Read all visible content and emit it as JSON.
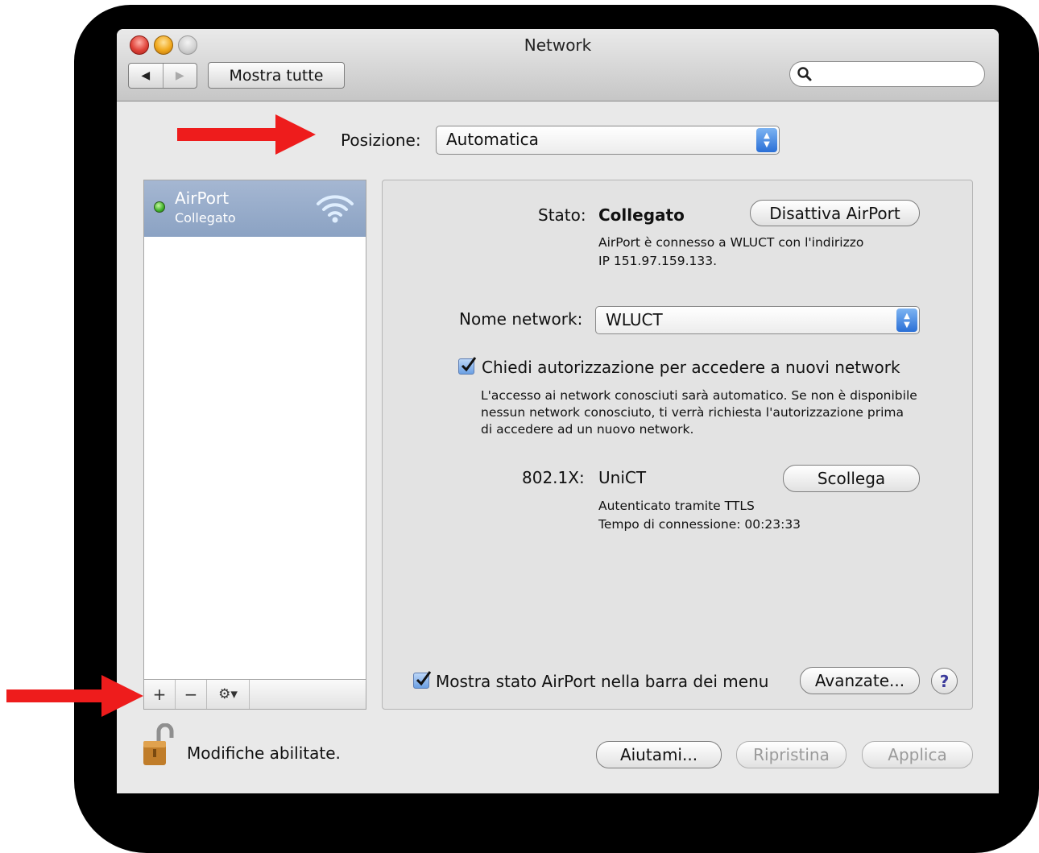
{
  "window": {
    "title": "Network",
    "toolbar": {
      "back_glyph": "◀",
      "forward_glyph": "▶",
      "show_all": "Mostra tutte",
      "search_value": ""
    }
  },
  "location": {
    "label": "Posizione:",
    "value": "Automatica"
  },
  "sidebar": {
    "services": [
      {
        "name": "AirPort",
        "status": "Collegato",
        "status_color": "#3eb12a",
        "icon": "wifi-icon"
      }
    ],
    "tools": {
      "add": "+",
      "remove": "−",
      "gear": "⚙▾"
    }
  },
  "detail": {
    "status_label": "Stato:",
    "status_value": "Collegato",
    "turn_off_button": "Disattiva AirPort",
    "status_desc_line1": "AirPort è connesso a WLUCT con l'indirizzo",
    "status_desc_line2": "IP 151.97.159.133.",
    "network_name_label": "Nome network:",
    "network_name_value": "WLUCT",
    "ask_join_label": "Chiedi autorizzazione per accedere a nuovi network",
    "ask_join_checked": true,
    "ask_join_desc_line1": "L'accesso ai network conosciuti sarà automatico. Se non è disponibile",
    "ask_join_desc_line2": "nessun network conosciuto, ti verrà richiesta l'autorizzazione prima",
    "ask_join_desc_line3": "di accedere ad un nuovo network.",
    "dot1x_label": "802.1X:",
    "dot1x_value": "UniCT",
    "disconnect_button": "Scollega",
    "dot1x_desc_line1": "Autenticato tramite TTLS",
    "dot1x_desc_line2": "Tempo di connessione: 00:23:33",
    "show_status_label": "Mostra stato AirPort nella barra dei menu",
    "show_status_checked": true,
    "advanced_button": "Avanzate...",
    "help_button": "?"
  },
  "footer": {
    "lock_text": "Modifiche abilitate.",
    "assist_button": "Aiutami...",
    "revert_button": "Ripristina",
    "apply_button": "Applica"
  },
  "colors": {
    "annotation_arrow": "#ee1c1c",
    "selection": "#8ba2c3",
    "checkbox": "#6b9fe3"
  }
}
